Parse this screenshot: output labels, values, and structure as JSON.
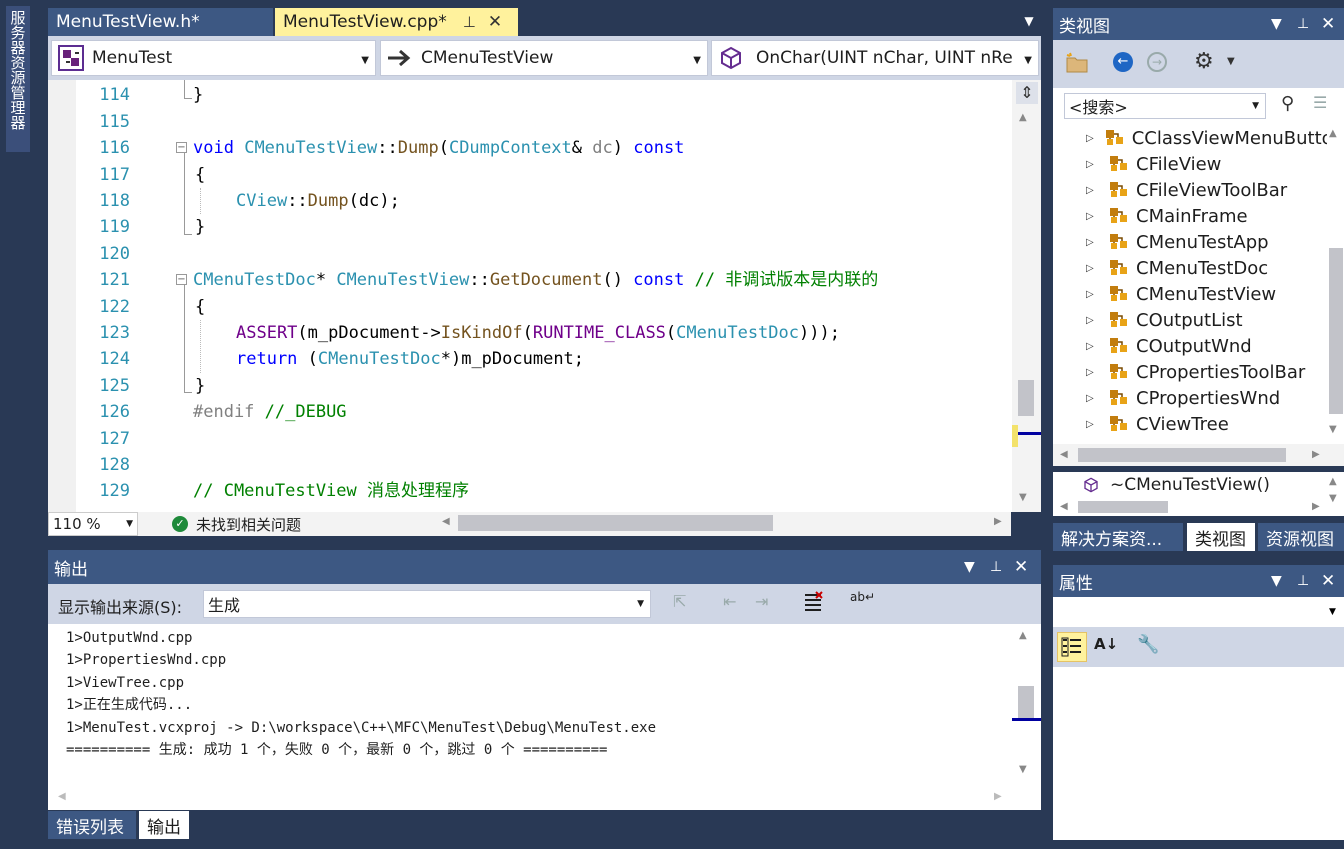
{
  "left_tab": "服务器资源管理器",
  "doc_tabs": [
    {
      "label": "MenuTestView.h*"
    },
    {
      "label": "MenuTestView.cpp*"
    }
  ],
  "nav": {
    "project": "MenuTest",
    "class": "CMenuTestView",
    "member": "OnChar(UINT nChar, UINT nRe"
  },
  "editor": {
    "line_numbers": [
      "114",
      "115",
      "116",
      "117",
      "118",
      "119",
      "120",
      "121",
      "122",
      "123",
      "124",
      "125",
      "126",
      "127",
      "128",
      "129"
    ],
    "lines": {
      "l114": "}",
      "l116_kw": "void",
      "l116_cls": "CMenuTestView",
      "l116_sep": "::",
      "l116_fn": "Dump",
      "l116_p1": "(",
      "l116_ty": "CDumpContext",
      "l116_amp": "& ",
      "l116_arg": "dc",
      "l116_p2": ") ",
      "l116_const": "const",
      "l117": "{",
      "l118_ty": "CView",
      "l118_sep": "::",
      "l118_fn": "Dump",
      "l118_rest": "(dc);",
      "l119": "}",
      "l121_ty": "CMenuTestDoc",
      "l121_star": "* ",
      "l121_cls": "CMenuTestView",
      "l121_sep": "::",
      "l121_fn": "GetDocument",
      "l121_paren": "() ",
      "l121_const": "const",
      "l121_cm": " // 非调试版本是内联的",
      "l122": "{",
      "l123_mc": "ASSERT",
      "l123_a": "(m_pDocument->",
      "l123_fn": "IsKindOf",
      "l123_b": "(",
      "l123_mc2": "RUNTIME_CLASS",
      "l123_c": "(",
      "l123_ty": "CMenuTestDoc",
      "l123_d": ")));",
      "l124_kw": "return",
      "l124_a": " (",
      "l124_ty": "CMenuTestDoc",
      "l124_b": "*)m_pDocument;",
      "l125": "}",
      "l126_pp": "#endif",
      "l126_cm": " //_DEBUG",
      "l129_cm": "// CMenuTestView 消息处理程序"
    }
  },
  "status": {
    "zoom": "110 %",
    "issues": "未找到相关问题"
  },
  "output": {
    "title": "输出",
    "source_label": "显示输出来源(S):",
    "source_value": "生成",
    "lines": [
      "1>OutputWnd.cpp",
      "1>PropertiesWnd.cpp",
      "1>ViewTree.cpp",
      "1>正在生成代码...",
      "1>MenuTest.vcxproj -> D:\\workspace\\C++\\MFC\\MenuTest\\Debug\\MenuTest.exe",
      "========== 生成: 成功 1 个，失败 0 个，最新 0 个，跳过 0 个 =========="
    ],
    "tabs": [
      "错误列表",
      "输出"
    ]
  },
  "class_view": {
    "title": "类视图",
    "search_placeholder": "<搜索>",
    "items": [
      "CClassViewMenuButto",
      "CFileView",
      "CFileViewToolBar",
      "CMainFrame",
      "CMenuTestApp",
      "CMenuTestDoc",
      "CMenuTestView",
      "COutputList",
      "COutputWnd",
      "CPropertiesToolBar",
      "CPropertiesWnd",
      "CViewTree"
    ],
    "member": "~CMenuTestView()",
    "tabs": [
      "解决方案资...",
      "类视图",
      "资源视图"
    ]
  },
  "properties": {
    "title": "属性"
  },
  "colors": {
    "frame": "#293955",
    "header": "#3d5883",
    "active_tab": "#fff29d",
    "toolbar": "#cfd6e5"
  }
}
